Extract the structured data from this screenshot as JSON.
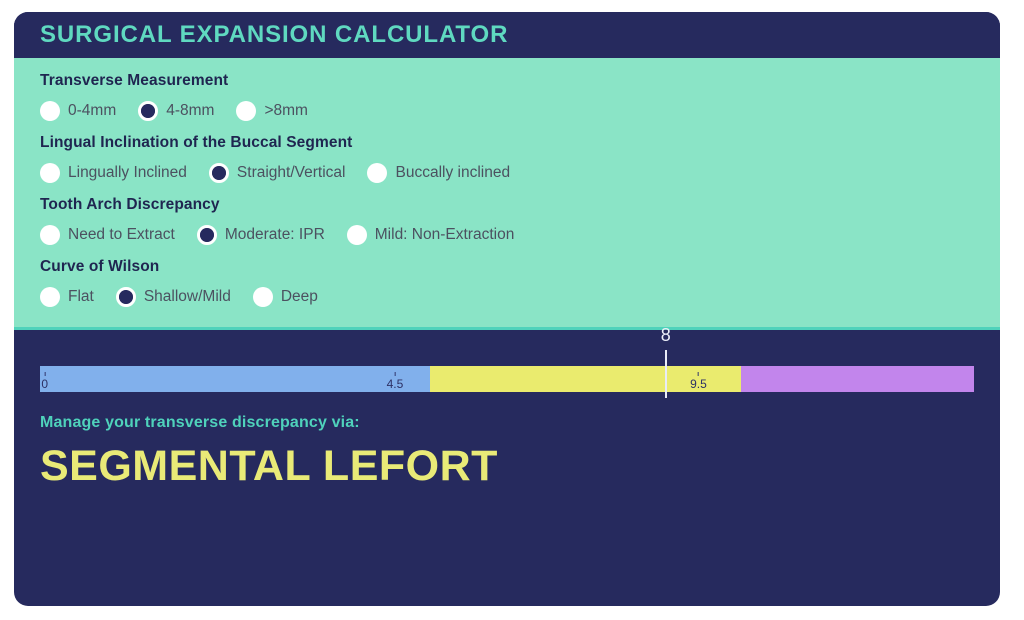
{
  "header": {
    "title": "SURGICAL EXPANSION CALCULATOR"
  },
  "colors": {
    "navy": "#262a5e",
    "mint": "#8ae4c6",
    "teal_accent": "#4fd2bb",
    "title_teal": "#5fd9c0",
    "headline_yellow": "#e9ea77",
    "segment_blue": "#81b0ec",
    "segment_yellow": "#eaeb6e",
    "segment_purple": "#c285ec",
    "marker_white": "#e9ecf7"
  },
  "questions": [
    {
      "label": "Transverse Measurement",
      "name": "transverse-measurement",
      "options": [
        {
          "label": "0-4mm",
          "selected": false
        },
        {
          "label": "4-8mm",
          "selected": true
        },
        {
          "label": ">8mm",
          "selected": false
        }
      ]
    },
    {
      "label": "Lingual Inclination of the Buccal Segment",
      "name": "lingual-inclination",
      "options": [
        {
          "label": "Lingually Inclined",
          "selected": false
        },
        {
          "label": "Straight/Vertical",
          "selected": true
        },
        {
          "label": "Buccally inclined",
          "selected": false
        }
      ]
    },
    {
      "label": "Tooth Arch Discrepancy",
      "name": "tooth-arch-discrepancy",
      "options": [
        {
          "label": "Need to Extract",
          "selected": false
        },
        {
          "label": "Moderate: IPR",
          "selected": true
        },
        {
          "label": "Mild: Non-Extraction",
          "selected": false
        }
      ]
    },
    {
      "label": "Curve of Wilson",
      "name": "curve-of-wilson",
      "options": [
        {
          "label": "Flat",
          "selected": false
        },
        {
          "label": "Shallow/Mild",
          "selected": true
        },
        {
          "label": "Deep",
          "selected": false
        }
      ]
    }
  ],
  "result": {
    "caption": "Manage your transverse discrepancy via:",
    "headline": "SEGMENTAL LEFORT",
    "scale": {
      "marker_value": "8",
      "marker_percent": 67.0,
      "segments": [
        {
          "name": "segment-low",
          "percent": 41.8,
          "color": "#81b0ec"
        },
        {
          "name": "segment-mid",
          "percent": 33.3,
          "color": "#eaeb6e"
        },
        {
          "name": "segment-high",
          "percent": 24.9,
          "color": "#c285ec"
        }
      ],
      "ticks": [
        {
          "label": "0",
          "percent": 0.5
        },
        {
          "label": "4.5",
          "percent": 38.0
        },
        {
          "label": "9.5",
          "percent": 70.5
        }
      ]
    }
  }
}
